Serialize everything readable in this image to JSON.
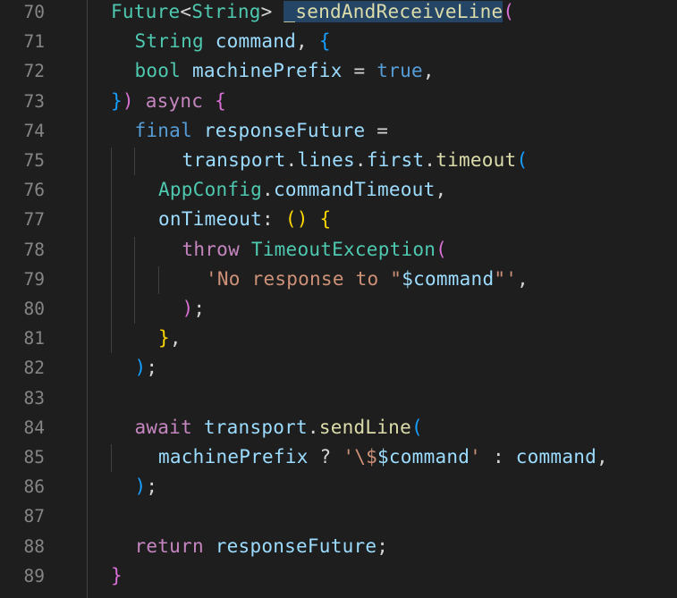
{
  "editor": {
    "theme": {
      "background": "#1e1e1e",
      "line_number": "#858585",
      "default": "#d4d4d4",
      "keyword": "#c586c0",
      "declaration": "#569cd6",
      "type": "#4ec9b0",
      "variable": "#9cdcfe",
      "function": "#dcdcaa",
      "string": "#ce9178",
      "bracket_level_1": "#ffd700",
      "bracket_level_2": "#da70d6",
      "bracket_level_3": "#179fff",
      "selection": "#264f78"
    },
    "lines": [
      {
        "num": "70",
        "indent": 0,
        "tokens": [
          {
            "t": "Future",
            "k": "type"
          },
          {
            "t": "<",
            "k": "op"
          },
          {
            "t": "String",
            "k": "type"
          },
          {
            "t": "> ",
            "k": "op"
          },
          {
            "t": "_sendAndReceiveLine",
            "k": "fn",
            "hl": true
          },
          {
            "t": "(",
            "k": "b2"
          }
        ]
      },
      {
        "num": "71",
        "indent": 1,
        "tokens": [
          {
            "t": "String",
            "k": "type"
          },
          {
            "t": " ",
            "k": "op"
          },
          {
            "t": "command",
            "k": "var"
          },
          {
            "t": ", ",
            "k": "op"
          },
          {
            "t": "{",
            "k": "b3"
          }
        ]
      },
      {
        "num": "72",
        "indent": 1,
        "tokens": [
          {
            "t": "bool",
            "k": "type"
          },
          {
            "t": " ",
            "k": "op"
          },
          {
            "t": "machinePrefix",
            "k": "var"
          },
          {
            "t": " = ",
            "k": "op"
          },
          {
            "t": "true",
            "k": "decl"
          },
          {
            "t": ",",
            "k": "op"
          }
        ]
      },
      {
        "num": "73",
        "indent": 0,
        "tokens": [
          {
            "t": "}",
            "k": "b3"
          },
          {
            "t": ")",
            "k": "b2"
          },
          {
            "t": " ",
            "k": "op"
          },
          {
            "t": "async",
            "k": "kw"
          },
          {
            "t": " ",
            "k": "op"
          },
          {
            "t": "{",
            "k": "b2"
          }
        ]
      },
      {
        "num": "74",
        "indent": 1,
        "tokens": [
          {
            "t": "final",
            "k": "decl"
          },
          {
            "t": " ",
            "k": "op"
          },
          {
            "t": "responseFuture",
            "k": "var"
          },
          {
            "t": " =",
            "k": "op"
          }
        ]
      },
      {
        "num": "75",
        "indent": 3,
        "tokens": [
          {
            "t": "transport",
            "k": "var"
          },
          {
            "t": ".",
            "k": "op"
          },
          {
            "t": "lines",
            "k": "var"
          },
          {
            "t": ".",
            "k": "op"
          },
          {
            "t": "first",
            "k": "var"
          },
          {
            "t": ".",
            "k": "op"
          },
          {
            "t": "timeout",
            "k": "fn"
          },
          {
            "t": "(",
            "k": "b3"
          }
        ]
      },
      {
        "num": "76",
        "indent": 2,
        "tokens": [
          {
            "t": "AppConfig",
            "k": "type"
          },
          {
            "t": ".",
            "k": "op"
          },
          {
            "t": "commandTimeout",
            "k": "var"
          },
          {
            "t": ",",
            "k": "op"
          }
        ]
      },
      {
        "num": "77",
        "indent": 2,
        "tokens": [
          {
            "t": "onTimeout",
            "k": "var"
          },
          {
            "t": ": ",
            "k": "op"
          },
          {
            "t": "()",
            "k": "b1"
          },
          {
            "t": " ",
            "k": "op"
          },
          {
            "t": "{",
            "k": "b1"
          }
        ]
      },
      {
        "num": "78",
        "indent": 3,
        "tokens": [
          {
            "t": "throw",
            "k": "kw"
          },
          {
            "t": " ",
            "k": "op"
          },
          {
            "t": "TimeoutException",
            "k": "type"
          },
          {
            "t": "(",
            "k": "b2"
          }
        ]
      },
      {
        "num": "79",
        "indent": 4,
        "tokens": [
          {
            "t": "'No response to \"",
            "k": "str"
          },
          {
            "t": "$command",
            "k": "var"
          },
          {
            "t": "\"'",
            "k": "str"
          },
          {
            "t": ",",
            "k": "op"
          }
        ]
      },
      {
        "num": "80",
        "indent": 3,
        "tokens": [
          {
            "t": ")",
            "k": "b2"
          },
          {
            "t": ";",
            "k": "op"
          }
        ]
      },
      {
        "num": "81",
        "indent": 2,
        "tokens": [
          {
            "t": "}",
            "k": "b1"
          },
          {
            "t": ",",
            "k": "op"
          }
        ]
      },
      {
        "num": "82",
        "indent": 1,
        "tokens": [
          {
            "t": ")",
            "k": "b3"
          },
          {
            "t": ";",
            "k": "op"
          }
        ]
      },
      {
        "num": "83",
        "indent": 0,
        "tokens": []
      },
      {
        "num": "84",
        "indent": 1,
        "tokens": [
          {
            "t": "await",
            "k": "kw"
          },
          {
            "t": " ",
            "k": "op"
          },
          {
            "t": "transport",
            "k": "var"
          },
          {
            "t": ".",
            "k": "op"
          },
          {
            "t": "sendLine",
            "k": "fn"
          },
          {
            "t": "(",
            "k": "b3"
          }
        ]
      },
      {
        "num": "85",
        "indent": 2,
        "tokens": [
          {
            "t": "machinePrefix",
            "k": "var"
          },
          {
            "t": " ? ",
            "k": "op"
          },
          {
            "t": "'\\$",
            "k": "str"
          },
          {
            "t": "$command",
            "k": "var"
          },
          {
            "t": "'",
            "k": "str"
          },
          {
            "t": " : ",
            "k": "op"
          },
          {
            "t": "command",
            "k": "var"
          },
          {
            "t": ",",
            "k": "op"
          }
        ]
      },
      {
        "num": "86",
        "indent": 1,
        "tokens": [
          {
            "t": ")",
            "k": "b3"
          },
          {
            "t": ";",
            "k": "op"
          }
        ]
      },
      {
        "num": "87",
        "indent": 0,
        "tokens": []
      },
      {
        "num": "88",
        "indent": 1,
        "tokens": [
          {
            "t": "return",
            "k": "kw"
          },
          {
            "t": " ",
            "k": "op"
          },
          {
            "t": "responseFuture",
            "k": "var"
          },
          {
            "t": ";",
            "k": "op"
          }
        ]
      },
      {
        "num": "89",
        "indent": 0,
        "tokens": [
          {
            "t": "}",
            "k": "b2"
          }
        ]
      }
    ]
  }
}
